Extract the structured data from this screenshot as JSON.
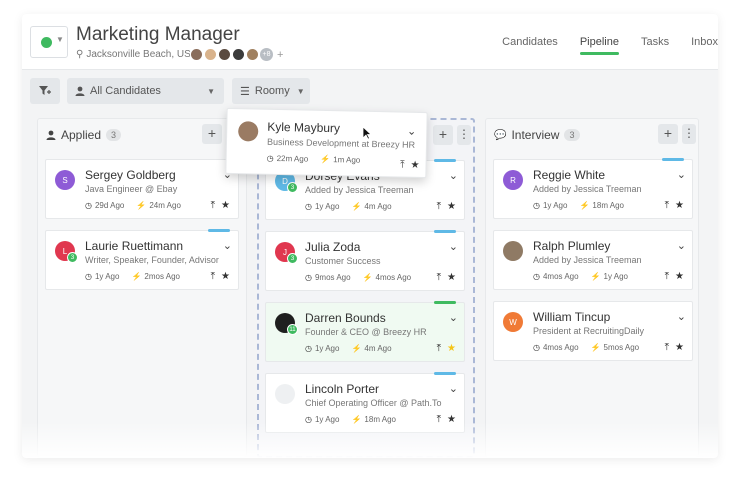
{
  "header": {
    "title": "Marketing Manager",
    "location": "Jacksonville Beach, US",
    "team_more": "+8",
    "team_add": "+",
    "nav": [
      "Candidates",
      "Pipeline",
      "Tasks",
      "Inbox"
    ],
    "active_nav": "Pipeline"
  },
  "toolbar": {
    "candidates_label": "All Candidates",
    "view_label": "Roomy"
  },
  "columns": {
    "applied": {
      "title": "Applied",
      "count": "3"
    },
    "shortlist": {
      "title": "",
      "count": ""
    },
    "interview": {
      "title": "Interview",
      "count": "3"
    }
  },
  "dragging": {
    "name": "Kyle Maybury",
    "subtitle": "Business Development at Breezy HR",
    "time1": "22m Ago",
    "time2": "1m Ago"
  },
  "cards": {
    "applied": [
      {
        "initial": "S",
        "name": "Sergey Goldberg",
        "subtitle": "Java Engineer @ Ebay",
        "time1": "29d Ago",
        "time2": "24m Ago"
      },
      {
        "initial": "L",
        "badge": "3",
        "name": "Laurie Ruettimann",
        "subtitle": "Writer, Speaker, Founder, Advisor",
        "time1": "1y Ago",
        "time2": "2mos Ago"
      }
    ],
    "shortlist": [
      {
        "initial": "D",
        "badge": "3",
        "name": "Dorsey Evans",
        "subtitle": "Added by Jessica Treeman",
        "time1": "1y Ago",
        "time2": "4m Ago"
      },
      {
        "initial": "J",
        "badge": "3",
        "name": "Julia Zoda",
        "subtitle": "Customer Success",
        "time1": "9mos Ago",
        "time2": "4mos Ago"
      },
      {
        "badge": "11",
        "name": "Darren Bounds",
        "subtitle": "Founder & CEO @ Breezy HR",
        "time1": "1y Ago",
        "time2": "4m Ago"
      },
      {
        "name": "Lincoln Porter",
        "subtitle": "Chief Operating Officer @ Path.To",
        "time1": "1y Ago",
        "time2": "18m Ago"
      }
    ],
    "interview": [
      {
        "initial": "R",
        "name": "Reggie White",
        "subtitle": "Added by Jessica Treeman",
        "time1": "1y Ago",
        "time2": "18m Ago"
      },
      {
        "name": "Ralph Plumley",
        "subtitle": "Added by Jessica Treeman",
        "time1": "4mos Ago",
        "time2": "1y Ago"
      },
      {
        "initial": "W",
        "name": "William Tincup",
        "subtitle": "President at RecruitingDaily",
        "time1": "4mos Ago",
        "time2": "5mos Ago"
      }
    ]
  },
  "colors": {
    "accent_green": "#3fba60",
    "tab_blue": "#5fb9e6",
    "avatar_purple": "#8e5bd6",
    "avatar_red": "#e0374f",
    "avatar_orange": "#f07a36",
    "star_gold": "#f5c518"
  },
  "icons": [
    "filter-icon",
    "user-icon",
    "list-icon",
    "location-pin-icon",
    "clock-icon",
    "bolt-icon",
    "upload-icon",
    "star-icon",
    "plus-icon",
    "more-icon",
    "chevron-down-icon",
    "chat-icon",
    "cursor-icon"
  ]
}
